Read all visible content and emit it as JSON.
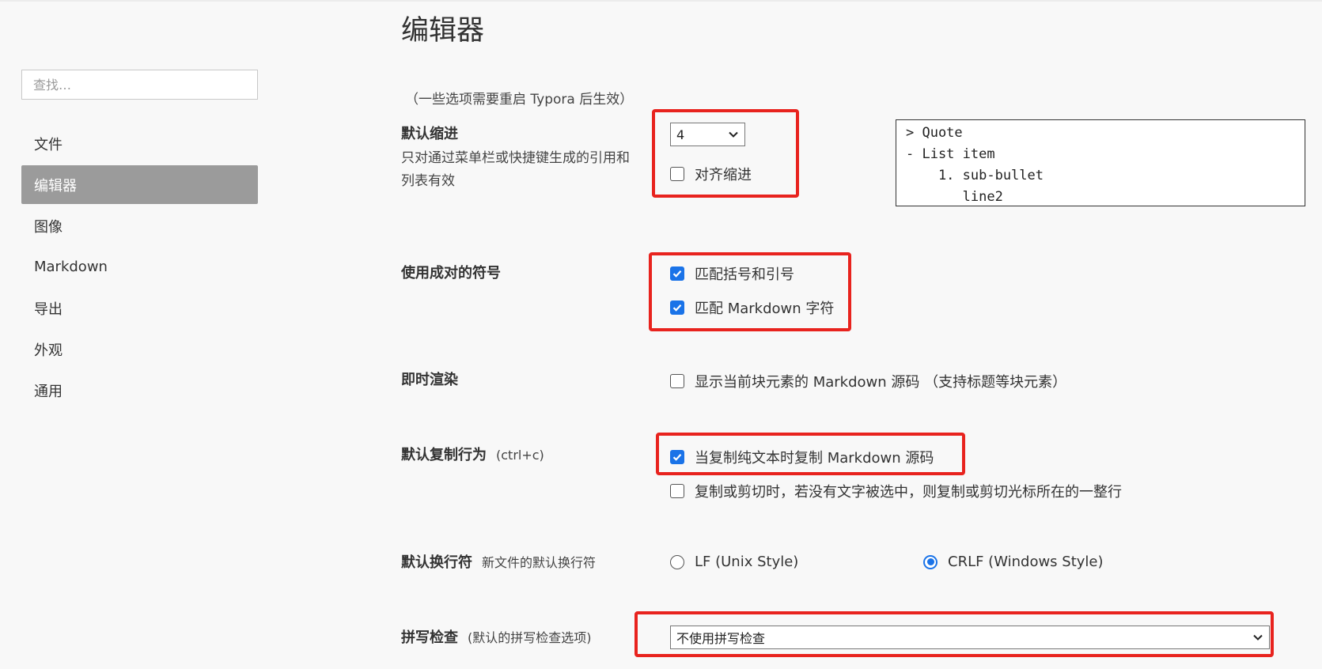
{
  "sidebar": {
    "search_placeholder": "查找…",
    "items": [
      {
        "label": "文件",
        "active": false
      },
      {
        "label": "编辑器",
        "active": true
      },
      {
        "label": "图像",
        "active": false
      },
      {
        "label": "Markdown",
        "active": false
      },
      {
        "label": "导出",
        "active": false
      },
      {
        "label": "外观",
        "active": false
      },
      {
        "label": "通用",
        "active": false
      }
    ]
  },
  "main": {
    "title": "编辑器",
    "restart_hint": "（一些选项需要重启 Typora 后生效）",
    "indent": {
      "label": "默认缩进",
      "description": "只对通过菜单栏或快捷键生成的引用和列表有效",
      "value": "4",
      "align_label": "对齐缩进",
      "align_checked": false,
      "preview_lines": [
        "> Quote",
        "- List item",
        "    1. sub-bullet",
        "       line2"
      ]
    },
    "pairs": {
      "label": "使用成对的符号",
      "match_brackets_label": "匹配括号和引号",
      "match_brackets_checked": true,
      "match_markdown_label": "匹配 Markdown 字符",
      "match_markdown_checked": true
    },
    "live_render": {
      "label": "即时渲染",
      "option_label": "显示当前块元素的 Markdown 源码 （支持标题等块元素）",
      "option_checked": false
    },
    "copy": {
      "label": "默认复制行为",
      "shortcut": "(ctrl+c)",
      "copy_md_label": "当复制纯文本时复制 Markdown 源码",
      "copy_md_checked": true,
      "copy_line_label": "复制或剪切时，若没有文字被选中，则复制或剪切光标所在的一整行",
      "copy_line_checked": false
    },
    "line_ending": {
      "label": "默认换行符",
      "sub": "新文件的默认换行符",
      "lf_label": "LF (Unix Style)",
      "crlf_label": "CRLF (Windows Style)",
      "selected": "CRLF"
    },
    "spellcheck": {
      "label": "拼写检查",
      "sub": "(默认的拼写检查选项)",
      "value": "不使用拼写检查"
    }
  },
  "colors": {
    "accent": "#1a73e8",
    "highlight": "#e8231e",
    "sidebar_active_bg": "#9b9b9b",
    "background": "#f8f8f8"
  }
}
